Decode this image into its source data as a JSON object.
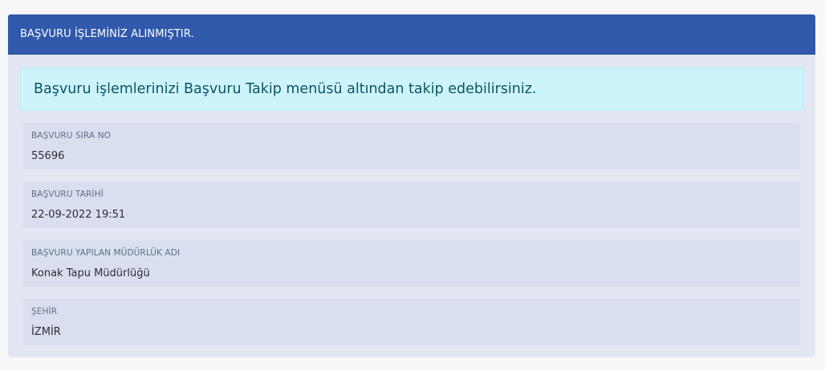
{
  "panel": {
    "title": "BAŞVURU İŞLEMİNİZ ALINMIŞTIR.",
    "info_message": "Başvuru işlemlerinizi Başvuru Takip menüsü altından takip edebilirsiniz.",
    "fields": [
      {
        "label": "BAŞVURU SIRA NO",
        "value": "55696"
      },
      {
        "label": "BAŞVURU TARİHİ",
        "value": "22-09-2022 19:51"
      },
      {
        "label": "BAŞVURU YAPILAN MÜDÜRLÜK ADI",
        "value": "Konak Tapu Müdürlüğü"
      },
      {
        "label": "ŞEHİR",
        "value": "İZMİR"
      }
    ]
  },
  "colors": {
    "header_bg": "#3159ab",
    "panel_bg": "#e3e7f2",
    "alert_bg": "#cef4fb",
    "alert_text": "#0b5566",
    "field_bg": "#d9dfee"
  }
}
